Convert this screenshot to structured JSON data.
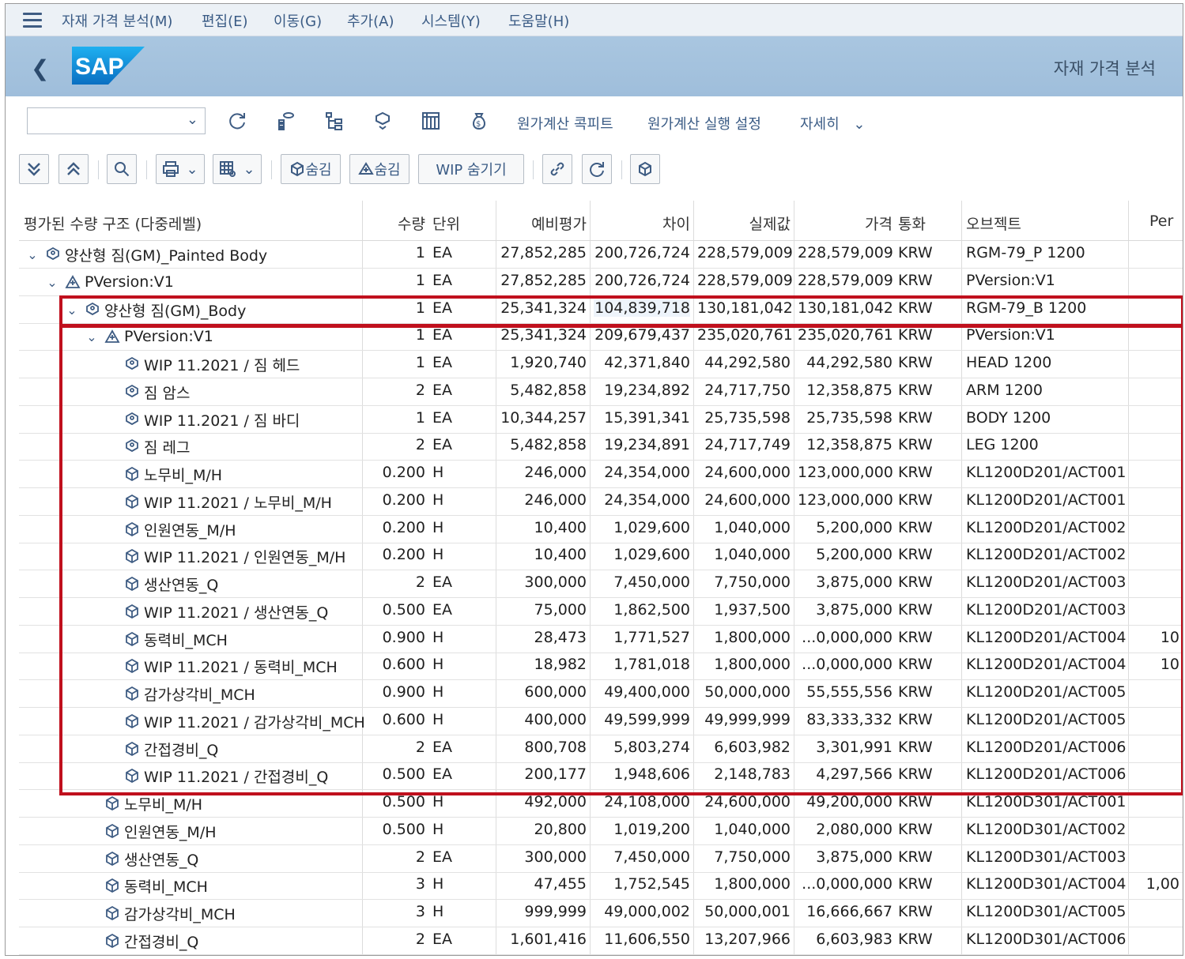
{
  "menu": [
    "자재 가격 분석(M)",
    "편집(E)",
    "이동(G)",
    "추가(A)",
    "시스템(Y)",
    "도움말(H)"
  ],
  "header": {
    "logo": "SAP",
    "title": "자재 가격 분석"
  },
  "toolbar1": {
    "select_value": "",
    "costing_cockpit": "원가계산 콕피트",
    "costing_run_settings": "원가계산 실행 설정",
    "more": "자세히"
  },
  "toolbar2": {
    "hide1": "숨김",
    "hide2": "숨김",
    "hide_wip": "WIP 숨기기"
  },
  "columns": [
    "평가된 수량 구조 (다중레벨)",
    "수량",
    "단위",
    "예비평가",
    "차이",
    "실제값",
    "가격",
    "통화",
    "오브젝트",
    "Per"
  ],
  "rows": [
    {
      "name": "양산형 짐(GM)_Painted Body",
      "qty": "1",
      "unit": "EA",
      "prelim": "27,852,285",
      "diff": "200,726,724",
      "actual": "228,579,009",
      "price": "228,579,009",
      "curr": "KRW",
      "obj": "RGM-79_P 1200",
      "per": ""
    },
    {
      "name": "PVersion:V1",
      "qty": "1",
      "unit": "EA",
      "prelim": "27,852,285",
      "diff": "200,726,724",
      "actual": "228,579,009",
      "price": "228,579,009",
      "curr": "KRW",
      "obj": "PVersion:V1",
      "per": ""
    },
    {
      "name": "양산형 짐(GM)_Body",
      "qty": "1",
      "unit": "EA",
      "prelim": "25,341,324",
      "diff": "104,839,718",
      "actual": "130,181,042",
      "price": "130,181,042",
      "curr": "KRW",
      "obj": "RGM-79_B 1200",
      "per": ""
    },
    {
      "name": "PVersion:V1",
      "qty": "1",
      "unit": "EA",
      "prelim": "25,341,324",
      "diff": "209,679,437",
      "actual": "235,020,761",
      "price": "235,020,761",
      "curr": "KRW",
      "obj": "PVersion:V1",
      "per": ""
    },
    {
      "name": "WIP 11.2021 / 짐 헤드",
      "qty": "1",
      "unit": "EA",
      "prelim": "1,920,740",
      "diff": "42,371,840",
      "actual": "44,292,580",
      "price": "44,292,580",
      "curr": "KRW",
      "obj": "HEAD 1200",
      "per": ""
    },
    {
      "name": "짐 암스",
      "qty": "2",
      "unit": "EA",
      "prelim": "5,482,858",
      "diff": "19,234,892",
      "actual": "24,717,750",
      "price": "12,358,875",
      "curr": "KRW",
      "obj": "ARM 1200",
      "per": ""
    },
    {
      "name": "WIP 11.2021 / 짐 바디",
      "qty": "1",
      "unit": "EA",
      "prelim": "10,344,257",
      "diff": "15,391,341",
      "actual": "25,735,598",
      "price": "25,735,598",
      "curr": "KRW",
      "obj": "BODY 1200",
      "per": ""
    },
    {
      "name": "짐 레그",
      "qty": "2",
      "unit": "EA",
      "prelim": "5,482,858",
      "diff": "19,234,891",
      "actual": "24,717,749",
      "price": "12,358,875",
      "curr": "KRW",
      "obj": "LEG 1200",
      "per": ""
    },
    {
      "name": "노무비_M/H",
      "qty": "0.200",
      "unit": "H",
      "prelim": "246,000",
      "diff": "24,354,000",
      "actual": "24,600,000",
      "price": "123,000,000",
      "curr": "KRW",
      "obj": "KL1200D201/ACT001",
      "per": ""
    },
    {
      "name": "WIP 11.2021 / 노무비_M/H",
      "qty": "0.200",
      "unit": "H",
      "prelim": "246,000",
      "diff": "24,354,000",
      "actual": "24,600,000",
      "price": "123,000,000",
      "curr": "KRW",
      "obj": "KL1200D201/ACT001",
      "per": ""
    },
    {
      "name": "인원연동_M/H",
      "qty": "0.200",
      "unit": "H",
      "prelim": "10,400",
      "diff": "1,029,600",
      "actual": "1,040,000",
      "price": "5,200,000",
      "curr": "KRW",
      "obj": "KL1200D201/ACT002",
      "per": ""
    },
    {
      "name": "WIP 11.2021 / 인원연동_M/H",
      "qty": "0.200",
      "unit": "H",
      "prelim": "10,400",
      "diff": "1,029,600",
      "actual": "1,040,000",
      "price": "5,200,000",
      "curr": "KRW",
      "obj": "KL1200D201/ACT002",
      "per": ""
    },
    {
      "name": "생산연동_Q",
      "qty": "2",
      "unit": "EA",
      "prelim": "300,000",
      "diff": "7,450,000",
      "actual": "7,750,000",
      "price": "3,875,000",
      "curr": "KRW",
      "obj": "KL1200D201/ACT003",
      "per": ""
    },
    {
      "name": "WIP 11.2021 / 생산연동_Q",
      "qty": "0.500",
      "unit": "EA",
      "prelim": "75,000",
      "diff": "1,862,500",
      "actual": "1,937,500",
      "price": "3,875,000",
      "curr": "KRW",
      "obj": "KL1200D201/ACT003",
      "per": ""
    },
    {
      "name": "동력비_MCH",
      "qty": "0.900",
      "unit": "H",
      "prelim": "28,473",
      "diff": "1,771,527",
      "actual": "1,800,000",
      "price": "...0,000,000",
      "curr": "KRW",
      "obj": "KL1200D201/ACT004",
      "per": "10"
    },
    {
      "name": "WIP 11.2021 / 동력비_MCH",
      "qty": "0.600",
      "unit": "H",
      "prelim": "18,982",
      "diff": "1,781,018",
      "actual": "1,800,000",
      "price": "...0,000,000",
      "curr": "KRW",
      "obj": "KL1200D201/ACT004",
      "per": "10"
    },
    {
      "name": "감가상각비_MCH",
      "qty": "0.900",
      "unit": "H",
      "prelim": "600,000",
      "diff": "49,400,000",
      "actual": "50,000,000",
      "price": "55,555,556",
      "curr": "KRW",
      "obj": "KL1200D201/ACT005",
      "per": ""
    },
    {
      "name": "WIP 11.2021 / 감가상각비_MCH",
      "qty": "0.600",
      "unit": "H",
      "prelim": "400,000",
      "diff": "49,599,999",
      "actual": "49,999,999",
      "price": "83,333,332",
      "curr": "KRW",
      "obj": "KL1200D201/ACT005",
      "per": ""
    },
    {
      "name": "간접경비_Q",
      "qty": "2",
      "unit": "EA",
      "prelim": "800,708",
      "diff": "5,803,274",
      "actual": "6,603,982",
      "price": "3,301,991",
      "curr": "KRW",
      "obj": "KL1200D201/ACT006",
      "per": ""
    },
    {
      "name": "WIP 11.2021 / 간접경비_Q",
      "qty": "0.500",
      "unit": "EA",
      "prelim": "200,177",
      "diff": "1,948,606",
      "actual": "2,148,783",
      "price": "4,297,566",
      "curr": "KRW",
      "obj": "KL1200D201/ACT006",
      "per": ""
    },
    {
      "name": "노무비_M/H",
      "qty": "0.500",
      "unit": "H",
      "prelim": "492,000",
      "diff": "24,108,000",
      "actual": "24,600,000",
      "price": "49,200,000",
      "curr": "KRW",
      "obj": "KL1200D301/ACT001",
      "per": ""
    },
    {
      "name": "인원연동_M/H",
      "qty": "0.500",
      "unit": "H",
      "prelim": "20,800",
      "diff": "1,019,200",
      "actual": "1,040,000",
      "price": "2,080,000",
      "curr": "KRW",
      "obj": "KL1200D301/ACT002",
      "per": ""
    },
    {
      "name": "생산연동_Q",
      "qty": "2",
      "unit": "EA",
      "prelim": "300,000",
      "diff": "7,450,000",
      "actual": "7,750,000",
      "price": "3,875,000",
      "curr": "KRW",
      "obj": "KL1200D301/ACT003",
      "per": ""
    },
    {
      "name": "동력비_MCH",
      "qty": "3",
      "unit": "H",
      "prelim": "47,455",
      "diff": "1,752,545",
      "actual": "1,800,000",
      "price": "...0,000,000",
      "curr": "KRW",
      "obj": "KL1200D301/ACT004",
      "per": "1,00"
    },
    {
      "name": "감가상각비_MCH",
      "qty": "3",
      "unit": "H",
      "prelim": "999,999",
      "diff": "49,000,002",
      "actual": "50,000,001",
      "price": "16,666,667",
      "curr": "KRW",
      "obj": "KL1200D301/ACT005",
      "per": ""
    },
    {
      "name": "간접경비_Q",
      "qty": "2",
      "unit": "EA",
      "prelim": "1,601,416",
      "diff": "11,606,550",
      "actual": "13,207,966",
      "price": "6,603,983",
      "curr": "KRW",
      "obj": "KL1200D301/ACT006",
      "per": ""
    }
  ],
  "colors": {
    "menu_text": "#3a5b85",
    "header_bg": "#a9c6e0",
    "sap_blue": "#1a8fd6",
    "highlight_box": "#c0101d"
  }
}
